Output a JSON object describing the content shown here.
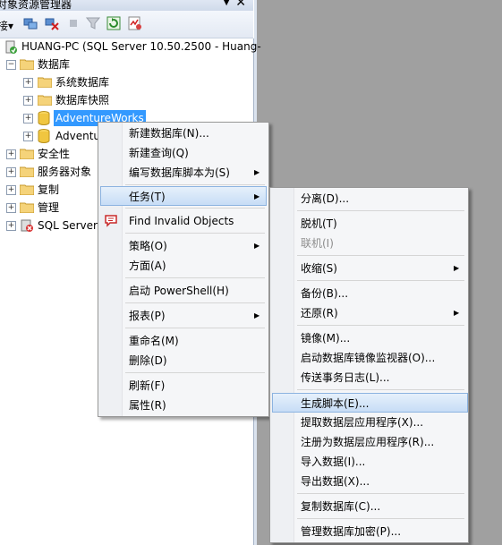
{
  "panel": {
    "title": "对象资源管理器",
    "pin_glyph": "▼",
    "close_glyph": "✕",
    "toolbar_lead": "接▾"
  },
  "tree": {
    "server": "HUANG-PC (SQL Server 10.50.2500 - Huang-",
    "items": [
      {
        "label": "数据库",
        "expand": "−"
      },
      {
        "label": "系统数据库",
        "expand": "+"
      },
      {
        "label": "数据库快照",
        "expand": "+"
      },
      {
        "label": "AdventureWorks",
        "expand": "+"
      },
      {
        "label": "Adventu",
        "expand": "+"
      },
      {
        "label": "安全性",
        "expand": "+"
      },
      {
        "label": "服务器对象",
        "expand": "+"
      },
      {
        "label": "复制",
        "expand": "+"
      },
      {
        "label": "管理",
        "expand": "+"
      },
      {
        "label": "SQL Server",
        "expand": "+"
      }
    ]
  },
  "context_menu": {
    "items": [
      {
        "label": "新建数据库(N)..."
      },
      {
        "label": "新建查询(Q)"
      },
      {
        "label": "编写数据库脚本为(S)",
        "arrow": "▶"
      },
      {
        "label": "任务(T)",
        "arrow": "▶"
      },
      {
        "label": "Find Invalid Objects"
      },
      {
        "label": "策略(O)",
        "arrow": "▶"
      },
      {
        "label": "方面(A)"
      },
      {
        "label": "启动 PowerShell(H)"
      },
      {
        "label": "报表(P)",
        "arrow": "▶"
      },
      {
        "label": "重命名(M)"
      },
      {
        "label": "删除(D)"
      },
      {
        "label": "刷新(F)"
      },
      {
        "label": "属性(R)"
      }
    ]
  },
  "tasks_menu": {
    "items": [
      {
        "label": "分离(D)..."
      },
      {
        "label": "脱机(T)"
      },
      {
        "label": "联机(I)"
      },
      {
        "label": "收缩(S)",
        "arrow": "▶"
      },
      {
        "label": "备份(B)..."
      },
      {
        "label": "还原(R)",
        "arrow": "▶"
      },
      {
        "label": "镜像(M)..."
      },
      {
        "label": "启动数据库镜像监视器(O)..."
      },
      {
        "label": "传送事务日志(L)..."
      },
      {
        "label": "生成脚本(E)..."
      },
      {
        "label": "提取数据层应用程序(X)..."
      },
      {
        "label": "注册为数据层应用程序(R)..."
      },
      {
        "label": "导入数据(I)..."
      },
      {
        "label": "导出数据(X)..."
      },
      {
        "label": "复制数据库(C)..."
      },
      {
        "label": "管理数据库加密(P)..."
      }
    ]
  },
  "colors": {
    "selection": "#3399ff",
    "highlight_border": "#8cb3e0",
    "background_gray": "#a0a0a0"
  }
}
